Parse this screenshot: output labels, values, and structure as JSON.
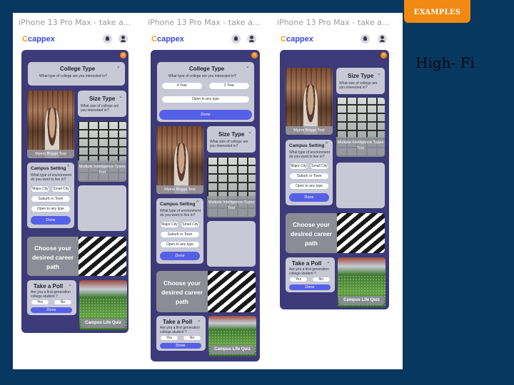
{
  "badge": "EXAMPLES",
  "heading": "High- Fi",
  "frame_label": "iPhone 13 Pro Max - take a...",
  "app": {
    "logo_mark": "C",
    "logo_text": "cappex"
  },
  "icons": {
    "close": "×",
    "chevron": "⌄",
    "chevron_up": "^"
  },
  "college_type": {
    "title": "College Type",
    "subtitle": "What type of college are you interested in?",
    "options": [
      "4 Year",
      "2 Year"
    ],
    "open": "Open to any type",
    "done": "Done"
  },
  "size_type": {
    "title": "Size Type",
    "subtitle": "What size of college are you interested in?"
  },
  "myers_briggs": "Myers Briggs Test",
  "multiple_intelligence": "Multiple Intelligence Types Test",
  "campus_setting": {
    "title": "Campus Setting",
    "subtitle": "What type of environment do you want to live in?",
    "options": [
      "Major City",
      "Small City",
      "Suburb or Town",
      "Open to any type"
    ],
    "done": "Done"
  },
  "career": "Choose your desired career path",
  "poll": {
    "title": "Take a Poll",
    "question": "Are you a first generation college student ?",
    "yes": "Yes",
    "no": "No",
    "done": "Done"
  },
  "campus_life": "Campus Life Quiz",
  "colors": {
    "background": "#083760",
    "screen": "#3c3a78",
    "accent": "#f08a12",
    "button": "#5560e8"
  }
}
